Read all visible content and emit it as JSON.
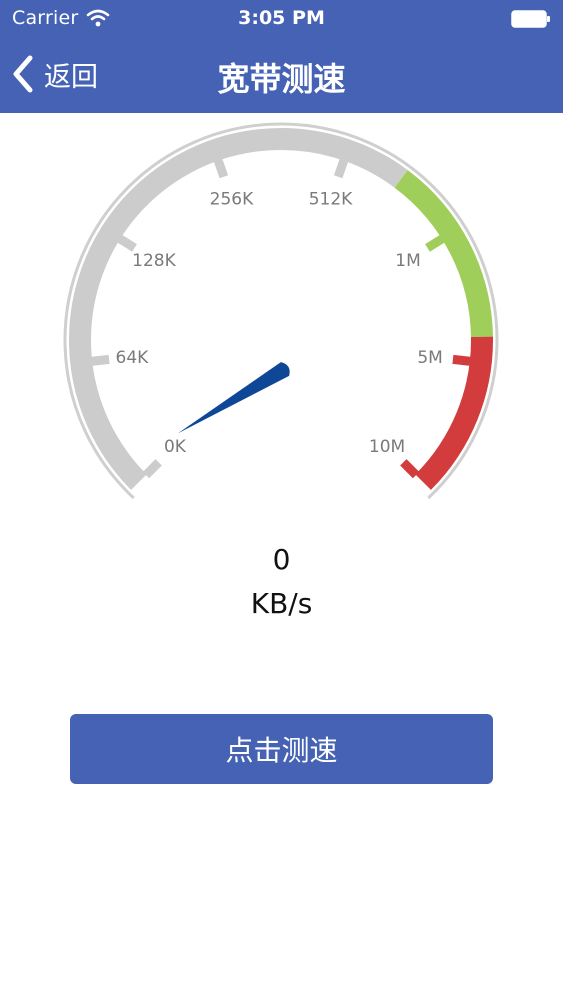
{
  "status_bar": {
    "carrier": "Carrier",
    "time": "3:05 PM"
  },
  "nav": {
    "back_label": "返回",
    "title": "宽带测速"
  },
  "gauge": {
    "tick_labels": [
      "0K",
      "64K",
      "128K",
      "256K",
      "512K",
      "1M",
      "5M",
      "10M"
    ],
    "needle_level": 0,
    "zones": [
      {
        "name": "normal",
        "color": "#cccccc"
      },
      {
        "name": "good",
        "color": "#9fcf5a"
      },
      {
        "name": "high",
        "color": "#d23c3c"
      }
    ],
    "needle_color": "#0f4797"
  },
  "readout": {
    "value": "0",
    "unit": "KB/s"
  },
  "action": {
    "start_label": "点击测速"
  },
  "colors": {
    "brand": "#4562b4",
    "text": "#111111",
    "tick_text": "#7a7a7a"
  }
}
